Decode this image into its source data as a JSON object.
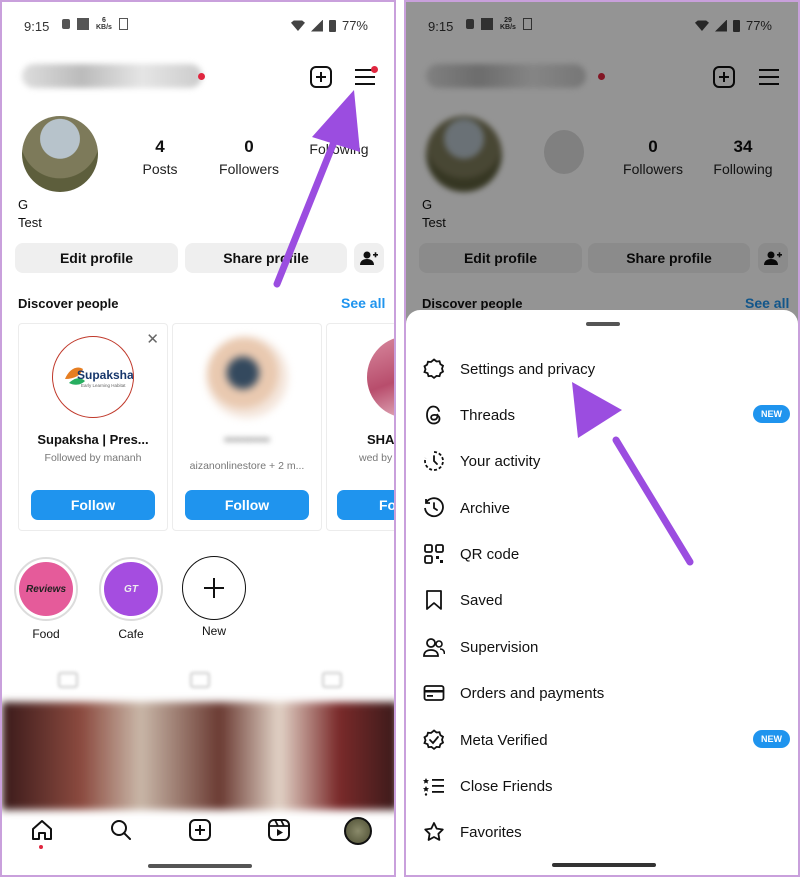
{
  "status": {
    "time": "9:15",
    "battery": "77%"
  },
  "left": {
    "stats": [
      {
        "num": "4",
        "label": "Posts"
      },
      {
        "num": "0",
        "label": "Followers"
      },
      {
        "num": "",
        "label": "Following"
      }
    ],
    "profile_name": "G",
    "profile_bio": "Test",
    "edit_profile": "Edit profile",
    "share_profile": "Share profile",
    "discover": "Discover people",
    "see_all": "See all",
    "cards": [
      {
        "name": "Supaksha | Pres...",
        "sub": "Followed by mananh",
        "follow": "Follow",
        "logo": "Supaksha",
        "logo_sub": "Early Learning Habitat"
      },
      {
        "name": "",
        "sub": "aizanonlinestore + 2 m...",
        "follow": "Follow"
      },
      {
        "name": "SHAH",
        "sub": "wed by _by_naj",
        "follow": "Fo"
      }
    ],
    "highlights": [
      {
        "label": "Food",
        "cover": "Reviews"
      },
      {
        "label": "Cafe",
        "cover": "GT"
      },
      {
        "label": "New"
      }
    ]
  },
  "right": {
    "stats": [
      {
        "num": "0",
        "label": "Followers"
      },
      {
        "num": "34",
        "label": "Following"
      }
    ],
    "menu": [
      {
        "label": "Settings and privacy",
        "icon": "gear-icon"
      },
      {
        "label": "Threads",
        "icon": "threads-icon",
        "badge": "NEW"
      },
      {
        "label": "Your activity",
        "icon": "activity-icon"
      },
      {
        "label": "Archive",
        "icon": "archive-icon"
      },
      {
        "label": "QR code",
        "icon": "qr-code-icon"
      },
      {
        "label": "Saved",
        "icon": "bookmark-icon"
      },
      {
        "label": "Supervision",
        "icon": "supervision-icon"
      },
      {
        "label": "Orders and payments",
        "icon": "card-icon"
      },
      {
        "label": "Meta Verified",
        "icon": "verified-icon",
        "badge": "NEW"
      },
      {
        "label": "Close Friends",
        "icon": "list-star-icon"
      },
      {
        "label": "Favorites",
        "icon": "star-icon"
      }
    ]
  },
  "colors": {
    "accent": "#1f94ee",
    "arrow": "#9b4de0",
    "notification": "#e0263f"
  }
}
